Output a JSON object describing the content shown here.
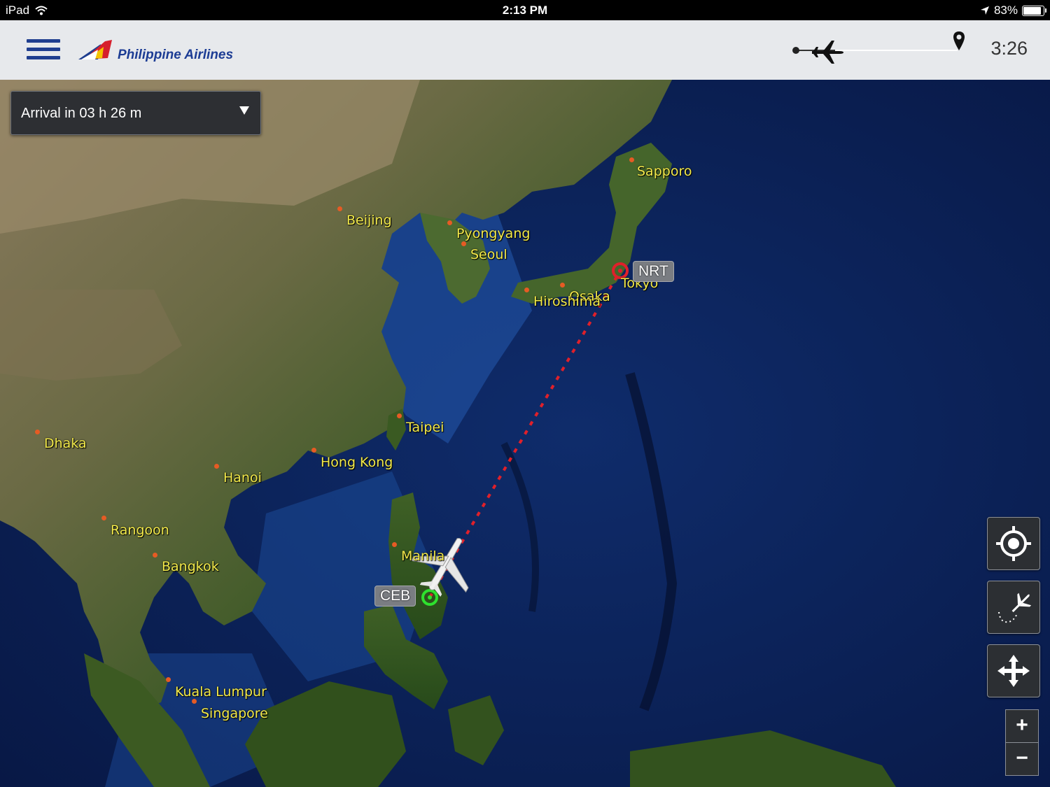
{
  "status_bar": {
    "device": "iPad",
    "time": "2:13 PM",
    "battery": "83%"
  },
  "header": {
    "airline": "Philippine Airlines",
    "time_remaining": "3:26"
  },
  "arrival_dropdown": {
    "label": "Arrival in 03 h 26 m"
  },
  "airports": {
    "origin": "CEB",
    "destination": "NRT"
  },
  "cities": {
    "sapporo": "Sapporo",
    "beijing": "Beijing",
    "pyongyang": "Pyongyang",
    "seoul": "Seoul",
    "tokyo": "Tokyo",
    "osaka": "Osaka",
    "hiroshima": "Hiroshima",
    "taipei": "Taipei",
    "dhaka": "Dhaka",
    "hong_kong": "Hong Kong",
    "hanoi": "Hanoi",
    "rangoon": "Rangoon",
    "bangkok": "Bangkok",
    "manila": "Manila",
    "kuala_lumpur": "Kuala Lumpur",
    "singapore": "Singapore"
  },
  "controls": {
    "zoom_in": "+",
    "zoom_out": "−"
  },
  "colors": {
    "brand_blue": "#1f3e8f",
    "route_red": "#e0202a",
    "label_yellow": "#f2e94a",
    "origin_green": "#2ee12e"
  }
}
